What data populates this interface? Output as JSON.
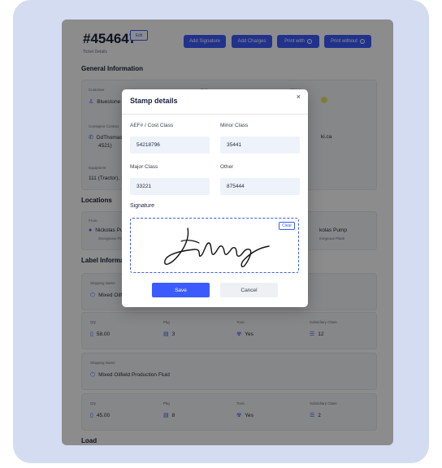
{
  "header": {
    "ticket_number": "#454647",
    "edit_label": "Edit",
    "subtitle": "Ticket Details",
    "add_signature": "Add Signature",
    "add_charges": "Add Charges",
    "print_with": "Print with",
    "print_without": "Print without"
  },
  "general": {
    "title": "General Information",
    "customer_label": "Customer",
    "customer_value": "Bluestone Oi",
    "date_label": "Date",
    "status_label": "Status",
    "consignor_label": "Consignor Contact",
    "consignor_line1": "DdThomas (1",
    "consignor_line2": "4521)",
    "consignor_right": "ki.ca",
    "equipment_label": "Equipment",
    "equipment_value": "111 (Tractor), 120"
  },
  "locations": {
    "title": "Locations",
    "from_label": "From",
    "from_value": "Nickolas Pump",
    "from_sub": "Georgeous Plank",
    "to_value": "kolas Pump",
    "to_sub": "eorgeous Plank"
  },
  "label_info": {
    "title": "Label Information",
    "items": [
      {
        "shipping_label": "Shipping Name",
        "shipping_value": "Mixed Oilfiel",
        "qty_label": "Qty",
        "qty_value": "58.00",
        "pkg_label": "Pkg",
        "pkg_value": "3",
        "toxic_label": "Toxic",
        "toxic_value": "Yes",
        "subsidiary_label": "Subsidiary Class",
        "subsidiary_value": "12"
      },
      {
        "shipping_label": "Shipping Name",
        "shipping_value": "Mixed Oilfield Production Fluid",
        "qty_label": "Qty",
        "qty_value": "45.00",
        "pkg_label": "Pkg",
        "pkg_value": "8",
        "toxic_label": "Toxic",
        "toxic_value": "Yes",
        "subsidiary_label": "Subsidiary Class",
        "subsidiary_value": "2"
      }
    ]
  },
  "load": {
    "title": "Load"
  },
  "modal": {
    "title": "Stamp details",
    "close": "×",
    "aef_label": "AEF# / Cost Class",
    "aef_value": "54218796",
    "minor_label": "Minor Class",
    "minor_value": "35441",
    "major_label": "Major Class",
    "major_value": "33221",
    "other_label": "Other",
    "other_value": "875444",
    "signature_label": "Signature",
    "clear_label": "Clear",
    "save_label": "Save",
    "cancel_label": "Cancel"
  },
  "colors": {
    "accent": "#3b5bfd",
    "frame": "#d3dcf0",
    "field_bg": "#eef2fa"
  }
}
